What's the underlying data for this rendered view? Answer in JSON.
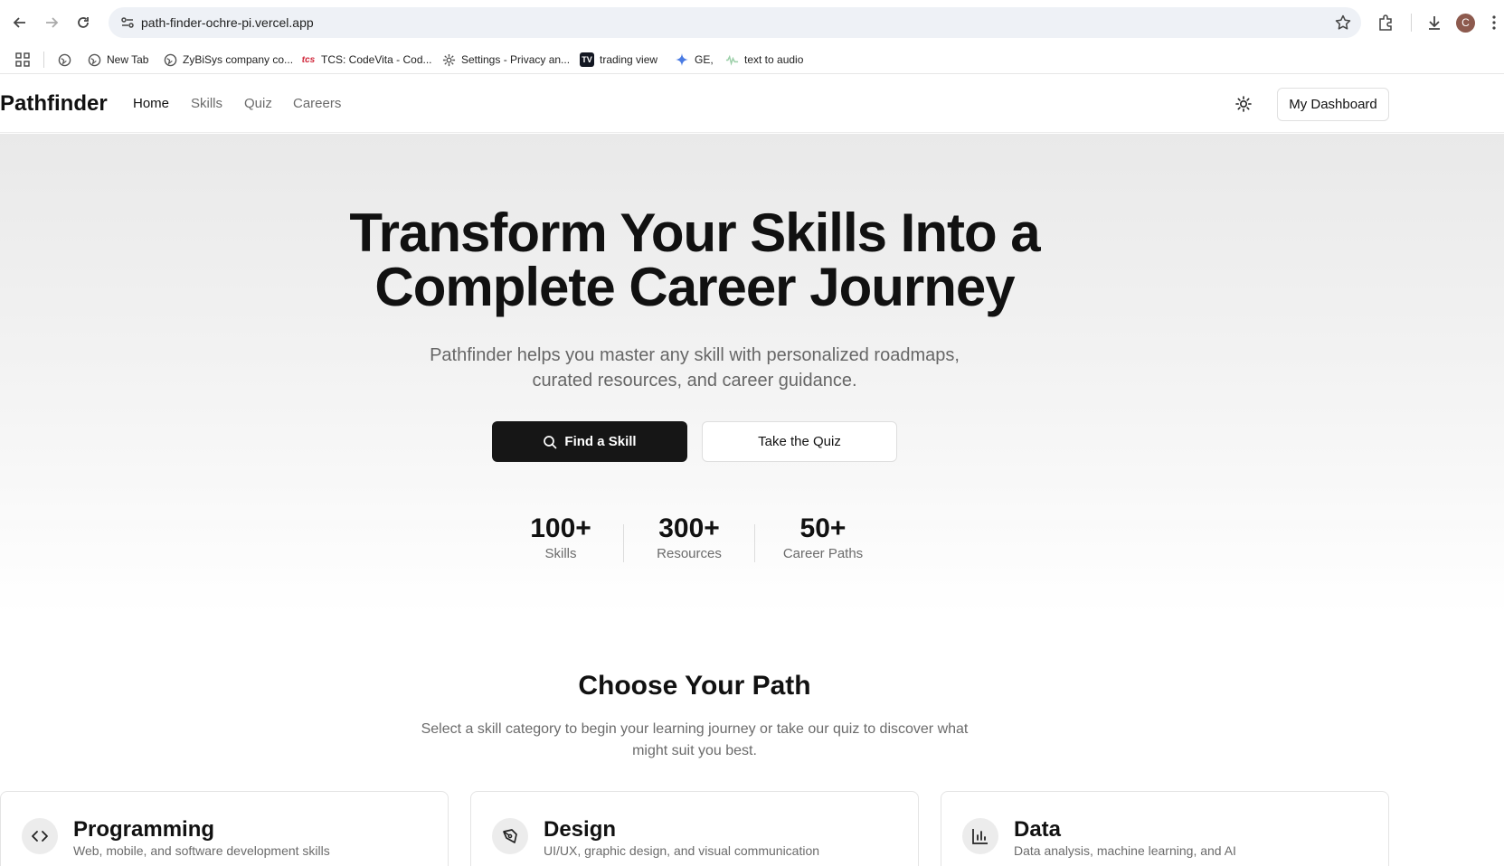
{
  "browser": {
    "url": "path-finder-ochre-pi.vercel.app",
    "profile_initial": "C",
    "bookmarks": [
      {
        "label": "",
        "icon": "globe-icon"
      },
      {
        "label": "New Tab",
        "icon": "globe-icon"
      },
      {
        "label": "ZyBiSys company co...",
        "icon": "globe-icon"
      },
      {
        "label": "TCS: CodeVita - Cod...",
        "icon": "tcs-icon"
      },
      {
        "label": "Settings - Privacy an...",
        "icon": "gear-icon"
      },
      {
        "label": "trading view",
        "icon": "tradingview-icon"
      },
      {
        "label": "GE,",
        "icon": "sparkle-icon"
      },
      {
        "label": "text to audio",
        "icon": "audio-icon"
      }
    ]
  },
  "header": {
    "brand": "Pathfinder",
    "nav": [
      {
        "label": "Home",
        "active": true
      },
      {
        "label": "Skills",
        "active": false
      },
      {
        "label": "Quiz",
        "active": false
      },
      {
        "label": "Careers",
        "active": false
      }
    ],
    "theme_icon": "sun-icon",
    "dashboard_label": "My Dashboard"
  },
  "hero": {
    "title_line1": "Transform Your Skills Into a",
    "title_line2": "Complete Career Journey",
    "subtitle_line1": "Pathfinder helps you master any skill with personalized roadmaps,",
    "subtitle_line2": "curated resources, and career guidance.",
    "primary_cta": "Find a Skill",
    "secondary_cta": "Take the Quiz",
    "stats": [
      {
        "value": "100+",
        "label": "Skills"
      },
      {
        "value": "300+",
        "label": "Resources"
      },
      {
        "value": "50+",
        "label": "Career Paths"
      }
    ]
  },
  "paths": {
    "title": "Choose Your Path",
    "subtitle_line1": "Select a skill category to begin your learning journey or take our quiz to discover what",
    "subtitle_line2": "might suit you best.",
    "cards": [
      {
        "title": "Programming",
        "description": "Web, mobile, and software development skills",
        "icon": "code-icon"
      },
      {
        "title": "Design",
        "description": "UI/UX, graphic design, and visual communication",
        "icon": "pen-tool-icon"
      },
      {
        "title": "Data",
        "description": "Data analysis, machine learning, and AI",
        "icon": "bar-chart-icon"
      }
    ]
  },
  "colors": {
    "primary_button": "#161616",
    "muted_text": "#6b6b6b",
    "hero_gradient_top": "#e9e9e9"
  }
}
